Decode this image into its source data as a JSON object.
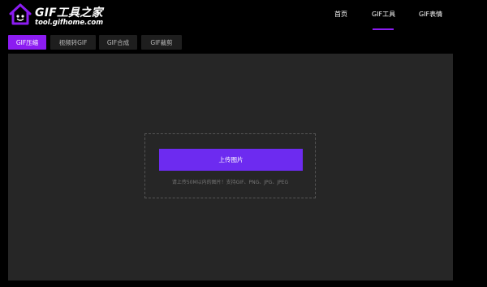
{
  "header": {
    "logo_title": "GIF工具之家",
    "logo_url": "tool.gifhome.com",
    "nav": [
      {
        "label": "首页",
        "active": false
      },
      {
        "label": "GIF工具",
        "active": true
      },
      {
        "label": "GIF表情",
        "active": false
      }
    ],
    "accent_color": "#8c1cf2"
  },
  "tabs": [
    {
      "label": "GIF压缩",
      "active": true
    },
    {
      "label": "视频转GIF",
      "active": false
    },
    {
      "label": "GIF合成",
      "active": false
    },
    {
      "label": "GIF裁剪",
      "active": false
    }
  ],
  "upload": {
    "button_label": "上传图片",
    "hint": "请上传50M以内的图片！支持GIF、PNG、JPG、JPEG",
    "button_color": "#6d2bf0"
  }
}
